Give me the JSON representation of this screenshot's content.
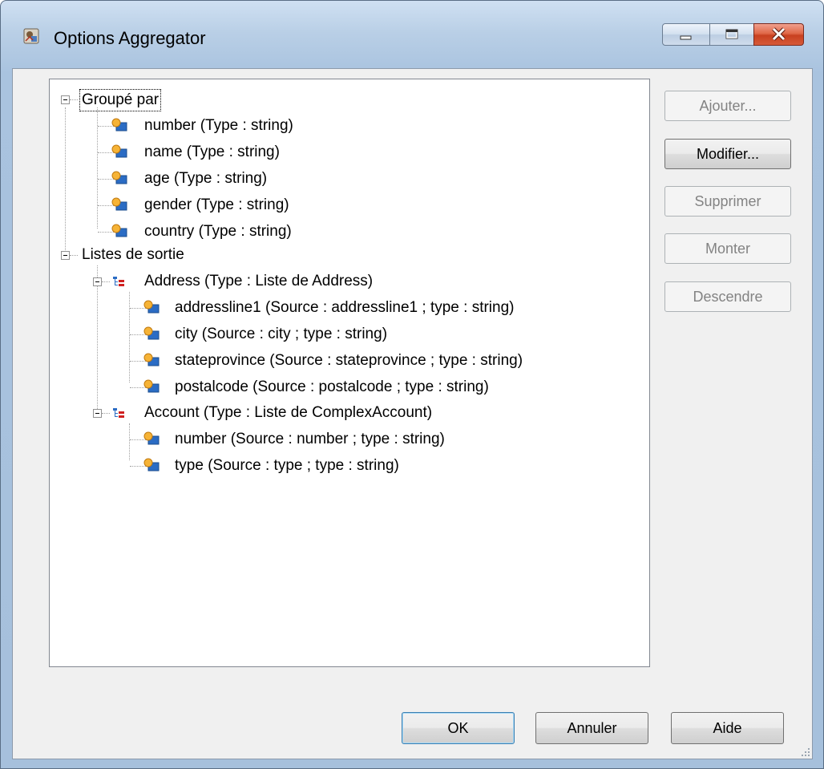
{
  "window": {
    "title": "Options Aggregator"
  },
  "tree": {
    "grouped": {
      "label": "Groupé par",
      "items": [
        "number (Type : string)",
        "name (Type : string)",
        "age (Type : string)",
        "gender (Type : string)",
        "country (Type : string)"
      ]
    },
    "outputs": {
      "label": "Listes de sortie",
      "lists": [
        {
          "label": "Address (Type : Liste de Address)",
          "items": [
            "addressline1 (Source : addressline1  ; type : string)",
            "city (Source : city ; type : string)",
            "stateprovince (Source : stateprovince ; type : string)",
            "postalcode (Source : postalcode ; type : string)"
          ]
        },
        {
          "label": "Account (Type : Liste de ComplexAccount)",
          "items": [
            "number (Source : number ; type : string)",
            "type (Source : type ; type : string)"
          ]
        }
      ]
    }
  },
  "side_buttons": {
    "add": "Ajouter...",
    "edit": "Modifier...",
    "delete": "Supprimer",
    "up": "Monter",
    "down": "Descendre"
  },
  "footer_buttons": {
    "ok": "OK",
    "cancel": "Annuler",
    "help": "Aide"
  },
  "colors": {
    "frame": "#b9cfe6",
    "client": "#f0f0f0",
    "close_button": "#c8401f",
    "default_button_border": "#3c7fb1"
  }
}
